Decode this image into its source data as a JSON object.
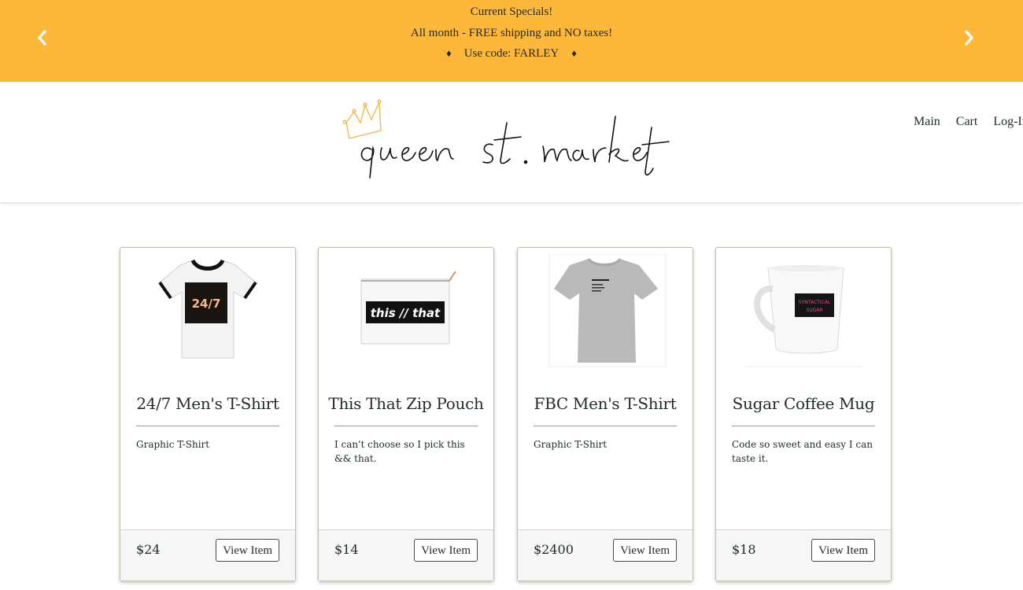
{
  "promo": {
    "line1": "Current Specials!",
    "line2": "All month - FREE shipping and NO taxes!",
    "line3": "Use code: FARLEY",
    "prev_icon": "chevron-left-icon",
    "next_icon": "chevron-right-icon"
  },
  "header": {
    "logo_text": "queen st. market",
    "nav": [
      "Main",
      "Cart",
      "Log-In"
    ]
  },
  "products": [
    {
      "title": "24/7 Men's T-Shirt",
      "description": "Graphic T-Shirt",
      "price": "$24",
      "button": "View Item",
      "image_text": "24/7"
    },
    {
      "title": "This That Zip Pouch",
      "description": "I can't choose so I pick this && that.",
      "price": "$14",
      "button": "View Item",
      "image_text": "this // that"
    },
    {
      "title": "FBC Men's T-Shirt",
      "description": "Graphic T-Shirt",
      "price": "$2400",
      "button": "View Item",
      "image_text": ""
    },
    {
      "title": "Sugar Coffee Mug",
      "description": "Code so sweet and easy I can taste it.",
      "price": "$18",
      "button": "View Item",
      "image_text": "SYNTACTICAL SUGAR"
    }
  ],
  "colors": {
    "banner": "#fdb83a",
    "text": "#1f2b2b",
    "footer_bg": "#f6f6f6"
  }
}
